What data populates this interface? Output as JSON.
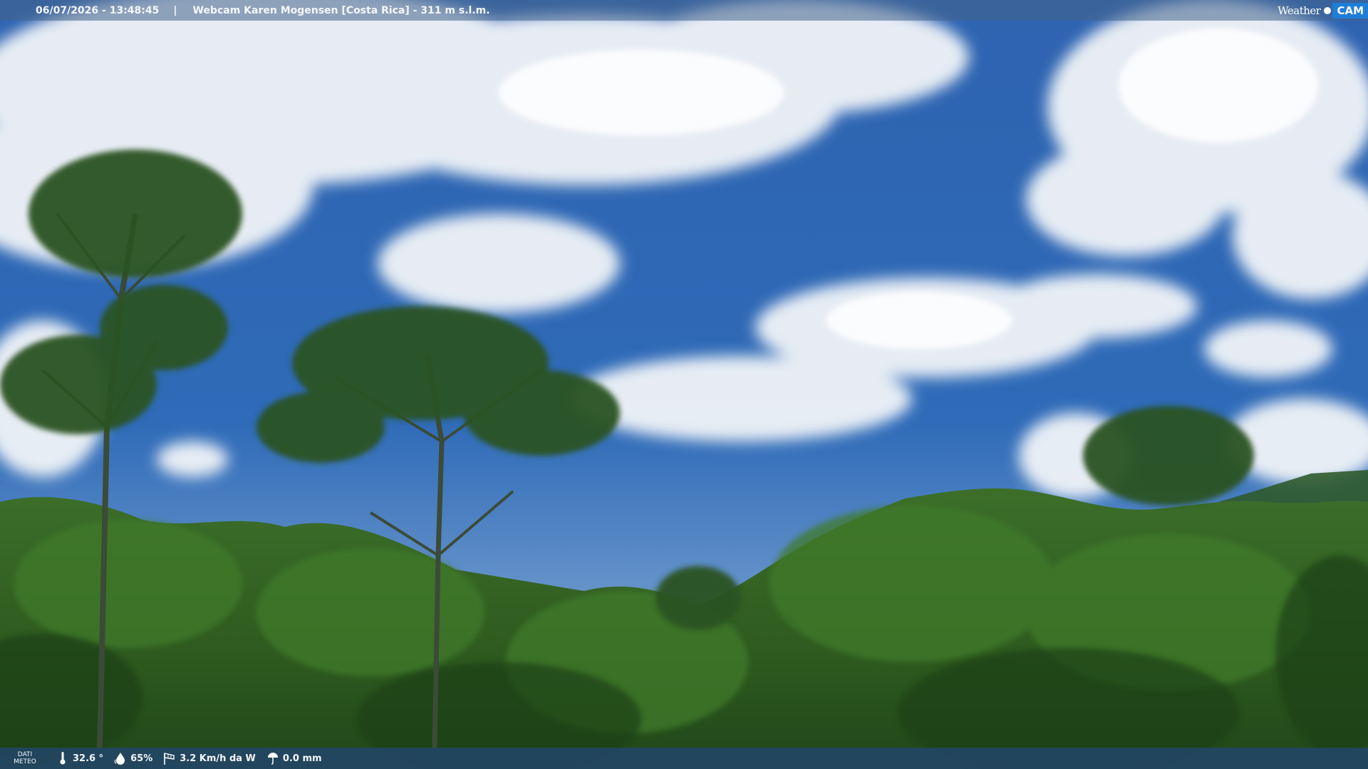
{
  "header": {
    "timestamp": "06/07/2026 - 13:48:45",
    "separator": "|",
    "camera_title": "Webcam Karen Mogensen [Costa Rica] - 311 m s.l.m."
  },
  "logo": {
    "weather_text": "Weather",
    "cam_text": "CAM"
  },
  "footer": {
    "section_label_line1": "DATI",
    "section_label_line2": "METEO",
    "temperature": "32.6 °",
    "humidity": "65%",
    "wind": "3.2 Km/h da W",
    "rain": "0.0 mm"
  },
  "icons": {
    "temperature": "thermometer-icon",
    "humidity": "droplet-icon",
    "wind": "wind-sock-icon",
    "rain": "rain-gauge-icon"
  },
  "colors": {
    "sky": "#1f5aa3",
    "foliage": "#2f5a1f",
    "logo_accent": "#1f7ed6"
  }
}
